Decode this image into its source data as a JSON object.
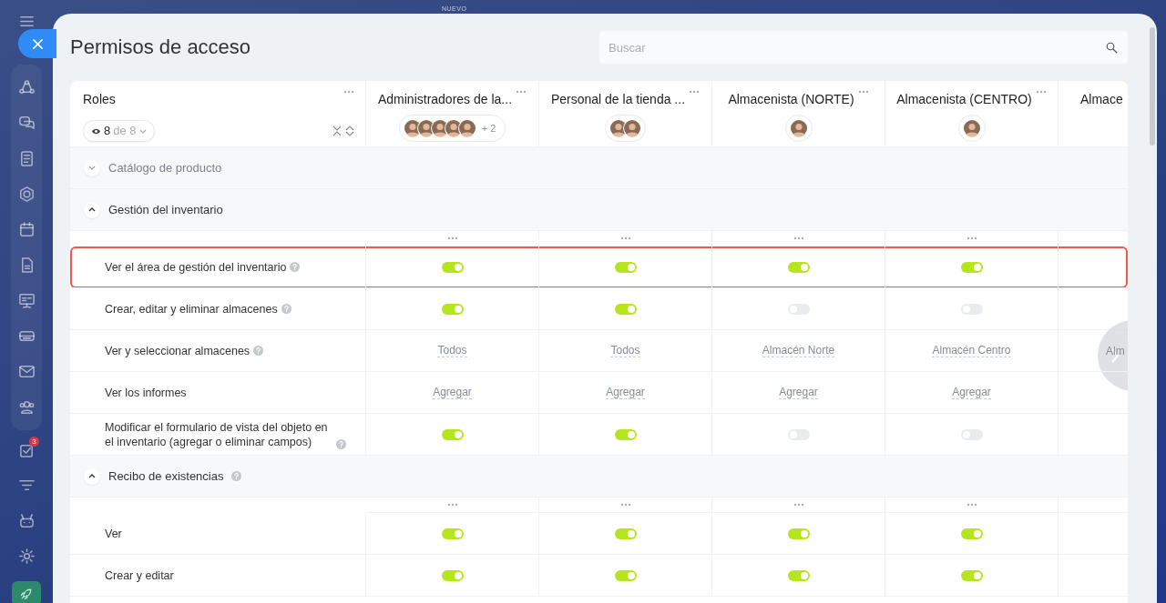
{
  "top_label": "NUEVO",
  "sidebar": {
    "tasks_badge": "3"
  },
  "title": "Permisos de acceso",
  "search": {
    "placeholder": "Buscar"
  },
  "roles_header": {
    "label": "Roles",
    "visible_count": "8",
    "total": "de 8"
  },
  "columns": [
    {
      "name": "Administradores de la...",
      "avatars": [
        {
          "kind": "photo"
        },
        {
          "kind": "photo"
        },
        {
          "kind": "photo"
        },
        {
          "kind": "photo"
        },
        {
          "kind": "photo"
        }
      ],
      "more": "+ 2"
    },
    {
      "name": "Personal de la tienda ...",
      "avatars": [
        {
          "kind": "photo"
        },
        {
          "kind": "photo"
        }
      ]
    },
    {
      "name": "Almacenista (NORTE)",
      "avatars": [
        {
          "kind": "photo"
        }
      ]
    },
    {
      "name": "Almacenista (CENTRO)",
      "avatars": [
        {
          "kind": "photo"
        }
      ]
    },
    {
      "name": "Almace"
    }
  ],
  "sections": [
    {
      "title": "Catálogo de producto",
      "expanded": false,
      "help": false
    },
    {
      "title": "Gestión del inventario",
      "expanded": true,
      "help": false,
      "rows": [
        {
          "label": "Ver el área de gestión del inventario",
          "help": true,
          "highlighted": true,
          "cells": [
            {
              "kind": "toggle",
              "on": true
            },
            {
              "kind": "toggle",
              "on": true
            },
            {
              "kind": "toggle",
              "on": true
            },
            {
              "kind": "toggle",
              "on": true
            }
          ]
        },
        {
          "label": "Crear, editar y eliminar almacenes",
          "help": true,
          "highlighted": false,
          "cells": [
            {
              "kind": "toggle",
              "on": true
            },
            {
              "kind": "toggle",
              "on": true
            },
            {
              "kind": "toggle",
              "on": false
            },
            {
              "kind": "toggle",
              "on": false
            }
          ]
        },
        {
          "label": "Ver y seleccionar almacenes",
          "help": true,
          "highlighted": false,
          "cells": [
            {
              "kind": "link",
              "text": "Todos"
            },
            {
              "kind": "link",
              "text": "Todos"
            },
            {
              "kind": "link",
              "text": "Almacén Norte"
            },
            {
              "kind": "link",
              "text": "Almacén Centro"
            },
            {
              "kind": "cut",
              "text": "Alm"
            }
          ]
        },
        {
          "label": "Ver los informes",
          "help": false,
          "highlighted": false,
          "cells": [
            {
              "kind": "link",
              "text": "Agregar"
            },
            {
              "kind": "link",
              "text": "Agregar"
            },
            {
              "kind": "link",
              "text": "Agregar"
            },
            {
              "kind": "link",
              "text": "Agregar"
            }
          ]
        },
        {
          "label": "Modificar el formulario de vista del objeto en el inventario (agregar o eliminar campos)",
          "help": true,
          "highlighted": false,
          "cells": [
            {
              "kind": "toggle",
              "on": true
            },
            {
              "kind": "toggle",
              "on": true
            },
            {
              "kind": "toggle",
              "on": false
            },
            {
              "kind": "toggle",
              "on": false
            }
          ]
        }
      ]
    },
    {
      "title": "Recibo de existencias",
      "expanded": true,
      "help": true,
      "rows": [
        {
          "label": "Ver",
          "help": false,
          "highlighted": false,
          "cells": [
            {
              "kind": "toggle",
              "on": true
            },
            {
              "kind": "toggle",
              "on": true
            },
            {
              "kind": "toggle",
              "on": true
            },
            {
              "kind": "toggle",
              "on": true
            }
          ]
        },
        {
          "label": "Crear y editar",
          "help": false,
          "highlighted": false,
          "cells": [
            {
              "kind": "toggle",
              "on": true
            },
            {
              "kind": "toggle",
              "on": true
            },
            {
              "kind": "toggle",
              "on": true
            },
            {
              "kind": "toggle",
              "on": true
            }
          ]
        }
      ]
    }
  ]
}
